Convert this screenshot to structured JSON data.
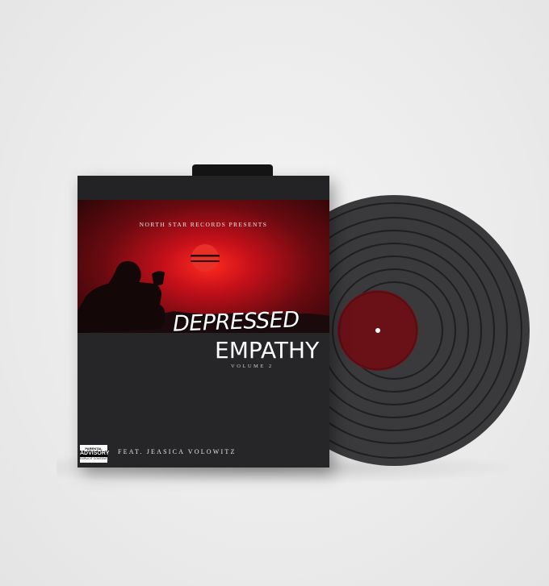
{
  "album": {
    "presents": "North Star Records Presents",
    "title_line1": "DEPRESSED",
    "title_line2": "EMPATHY",
    "volume": "Volume 2",
    "featuring": "Feat. Jeasica Volowitz"
  },
  "advisory": {
    "top": "PARENTAL",
    "middle": "ADVISORY",
    "bottom": "EXPLICIT CONTENT"
  },
  "colors": {
    "background": "#ececec",
    "sleeve": "#1c1c1e",
    "sky_red": "#b30d10",
    "sun": "#e01e1e",
    "vinyl": "#3c3c3e",
    "label": "#6a1118"
  },
  "objects": [
    "vinyl-record",
    "album-sleeve",
    "silhouette-figure",
    "setting-sun"
  ]
}
